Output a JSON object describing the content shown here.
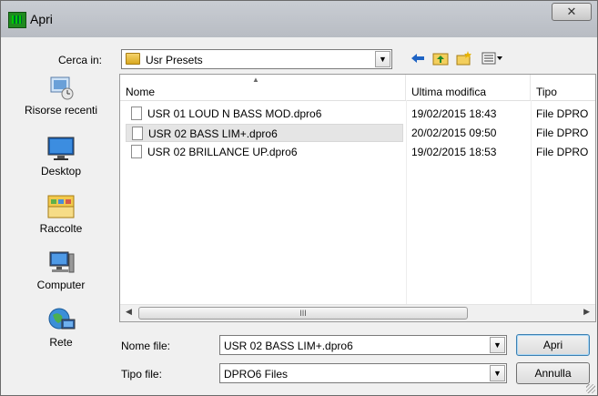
{
  "window": {
    "title": "Apri",
    "close_glyph": "✕"
  },
  "lookin": {
    "label": "Cerca in:",
    "folder": "Usr Presets",
    "dropdown_glyph": "▼"
  },
  "toolbar": {
    "back_icon": "back-arrow-icon",
    "up_icon": "up-folder-icon",
    "new_folder_icon": "new-folder-icon",
    "views_icon": "views-menu-icon"
  },
  "places": [
    {
      "label": "Risorse recenti",
      "icon": "recent-places-icon"
    },
    {
      "label": "Desktop",
      "icon": "desktop-icon"
    },
    {
      "label": "Raccolte",
      "icon": "libraries-icon"
    },
    {
      "label": "Computer",
      "icon": "computer-icon"
    },
    {
      "label": "Rete",
      "icon": "network-icon"
    }
  ],
  "columns": {
    "name": "Nome",
    "modified": "Ultima modifica",
    "type": "Tipo"
  },
  "files": [
    {
      "name": "USR 01 LOUD N BASS MOD.dpro6",
      "modified": "19/02/2015 18:43",
      "type": "File DPRO"
    },
    {
      "name": "USR 02 BASS LIM+.dpro6",
      "modified": "20/02/2015 09:50",
      "type": "File DPRO"
    },
    {
      "name": "USR 02 BRILLANCE UP.dpro6",
      "modified": "19/02/2015 18:53",
      "type": "File DPRO"
    }
  ],
  "filename": {
    "label": "Nome file:",
    "value": "USR 02 BASS LIM+.dpro6"
  },
  "filetype": {
    "label": "Tipo file:",
    "value": "DPRO6 Files"
  },
  "buttons": {
    "open": "Apri",
    "cancel": "Annulla"
  },
  "scrollbar": {
    "thumb_grip": "III"
  }
}
